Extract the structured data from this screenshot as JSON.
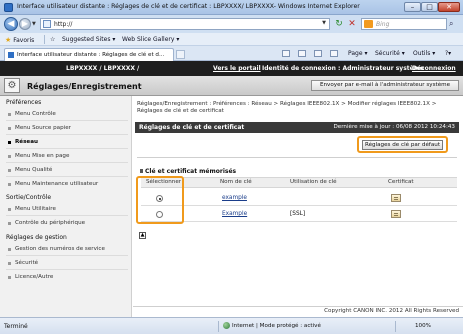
{
  "window": {
    "title": "Interface utilisateur distante : Réglages de clé et de certificat : LBPXXXX/ LBPXXXX- Windows Internet Explorer"
  },
  "addressbar": {
    "url": "http://",
    "search_placeholder": "Bing"
  },
  "favorites": {
    "label": "Favoris",
    "suggested": "Suggested Sites",
    "web_slice": "Web Slice Gallery"
  },
  "tab": {
    "label": "Interface utilisateur distante : Réglages de clé et d..."
  },
  "commands": {
    "page": "Page",
    "security": "Sécurité",
    "tools": "Outils"
  },
  "header": {
    "product": "LBPXXXX / LBPXXXX /",
    "portal_link": "Vers le portail",
    "login_info": "Identité de connexion : Administrateur système",
    "logout": "Déconnexion",
    "section_title": "Réglages/Enregistrement",
    "email_button": "Envoyer par e-mail à l'administrateur système"
  },
  "sidebar": {
    "groups": [
      {
        "title": "Préférences",
        "items": [
          "Menu Contrôle",
          "Menu Source papier",
          "Réseau",
          "Menu Mise en page",
          "Menu Qualité",
          "Menu Maintenance utilisateur"
        ]
      },
      {
        "title": "Sortie/Contrôle",
        "items": [
          "Menu Utilitaire",
          "Contrôle du périphérique"
        ]
      },
      {
        "title": "Réglages de gestion",
        "items": [
          "Gestion des numéros de service",
          "Sécurité",
          "Licence/Autre"
        ]
      }
    ],
    "active": "Réseau"
  },
  "main": {
    "breadcrumb_1": "Réglages/Enregistrement : Préférences : Réseau > Réglages IEEE802.1X > Modifier réglages IEEE802.1X >",
    "breadcrumb_2": "Réglages de clé et de certificat",
    "page_title": "Réglages de clé et de certificat",
    "last_update": "Dernière mise à jour : 06/08 2012 10:24:43",
    "default_button": "Réglages de clé par défaut",
    "list_title": "Clé et certificat mémorisés",
    "columns": [
      "Sélectionner",
      "Nom de clé",
      "Utilisation de clé",
      "Certificat"
    ],
    "rows": [
      {
        "selected": true,
        "key_name": "example",
        "usage": ""
      },
      {
        "selected": false,
        "key_name": "Example",
        "usage": "[SSL]"
      }
    ],
    "copyright": "Copyright CANON INC. 2012 All Rights Reserved"
  },
  "statusbar": {
    "status": "Terminé",
    "zone": "Internet | Mode protégé : activé",
    "zoom": "100%"
  }
}
